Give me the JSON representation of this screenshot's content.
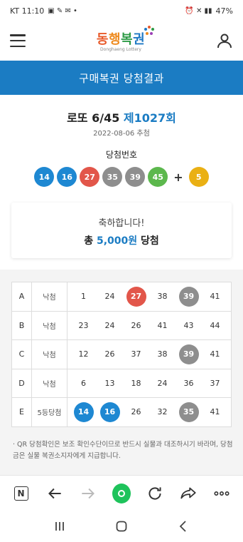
{
  "status_bar": {
    "left": "KT 11:10",
    "right": "47%"
  },
  "header": {
    "logo_main": [
      "동",
      "행",
      "복",
      "권"
    ],
    "logo_sub": "Donghaeng Lottery"
  },
  "banner": {
    "title": "구매복권 당첨결과"
  },
  "round": {
    "game": "로또 6/45",
    "number": "제1027회",
    "date": "2022-08-06 추첨"
  },
  "winning": {
    "label": "당첨번호",
    "numbers": [
      {
        "value": "14",
        "color": "#1e88d2"
      },
      {
        "value": "16",
        "color": "#1e88d2"
      },
      {
        "value": "27",
        "color": "#e2564a"
      },
      {
        "value": "35",
        "color": "#8e8e8e"
      },
      {
        "value": "39",
        "color": "#8e8e8e"
      },
      {
        "value": "45",
        "color": "#5cb84d"
      }
    ],
    "plus": "+",
    "bonus": {
      "value": "5",
      "color": "#eab014"
    }
  },
  "congrats": {
    "message": "축하합니다!",
    "prize_prefix": "총",
    "prize_amount": "5,000원",
    "prize_suffix": "당첨"
  },
  "ticket": [
    {
      "id": "A",
      "result": "낙첨",
      "numbers": [
        {
          "v": "1"
        },
        {
          "v": "24"
        },
        {
          "v": "27",
          "color": "#e2564a"
        },
        {
          "v": "38"
        },
        {
          "v": "39",
          "color": "#8e8e8e"
        },
        {
          "v": "41"
        }
      ]
    },
    {
      "id": "B",
      "result": "낙첨",
      "numbers": [
        {
          "v": "23"
        },
        {
          "v": "24"
        },
        {
          "v": "26"
        },
        {
          "v": "41"
        },
        {
          "v": "43"
        },
        {
          "v": "44"
        }
      ]
    },
    {
      "id": "C",
      "result": "낙첨",
      "numbers": [
        {
          "v": "12"
        },
        {
          "v": "26"
        },
        {
          "v": "37"
        },
        {
          "v": "38"
        },
        {
          "v": "39",
          "color": "#8e8e8e"
        },
        {
          "v": "41"
        }
      ]
    },
    {
      "id": "D",
      "result": "낙첨",
      "numbers": [
        {
          "v": "6"
        },
        {
          "v": "13"
        },
        {
          "v": "18"
        },
        {
          "v": "24"
        },
        {
          "v": "36"
        },
        {
          "v": "37"
        }
      ]
    },
    {
      "id": "E",
      "result": "5등당첨",
      "numbers": [
        {
          "v": "14",
          "color": "#1e88d2"
        },
        {
          "v": "16",
          "color": "#1e88d2"
        },
        {
          "v": "26"
        },
        {
          "v": "32"
        },
        {
          "v": "35",
          "color": "#8e8e8e"
        },
        {
          "v": "41"
        }
      ]
    }
  ],
  "notice": "· QR 당첨확인은 보조 확인수단이므로 반드시 실물과 대조하시기 바라며, 당첨금은 실물 복권소지자에게 지급합니다."
}
